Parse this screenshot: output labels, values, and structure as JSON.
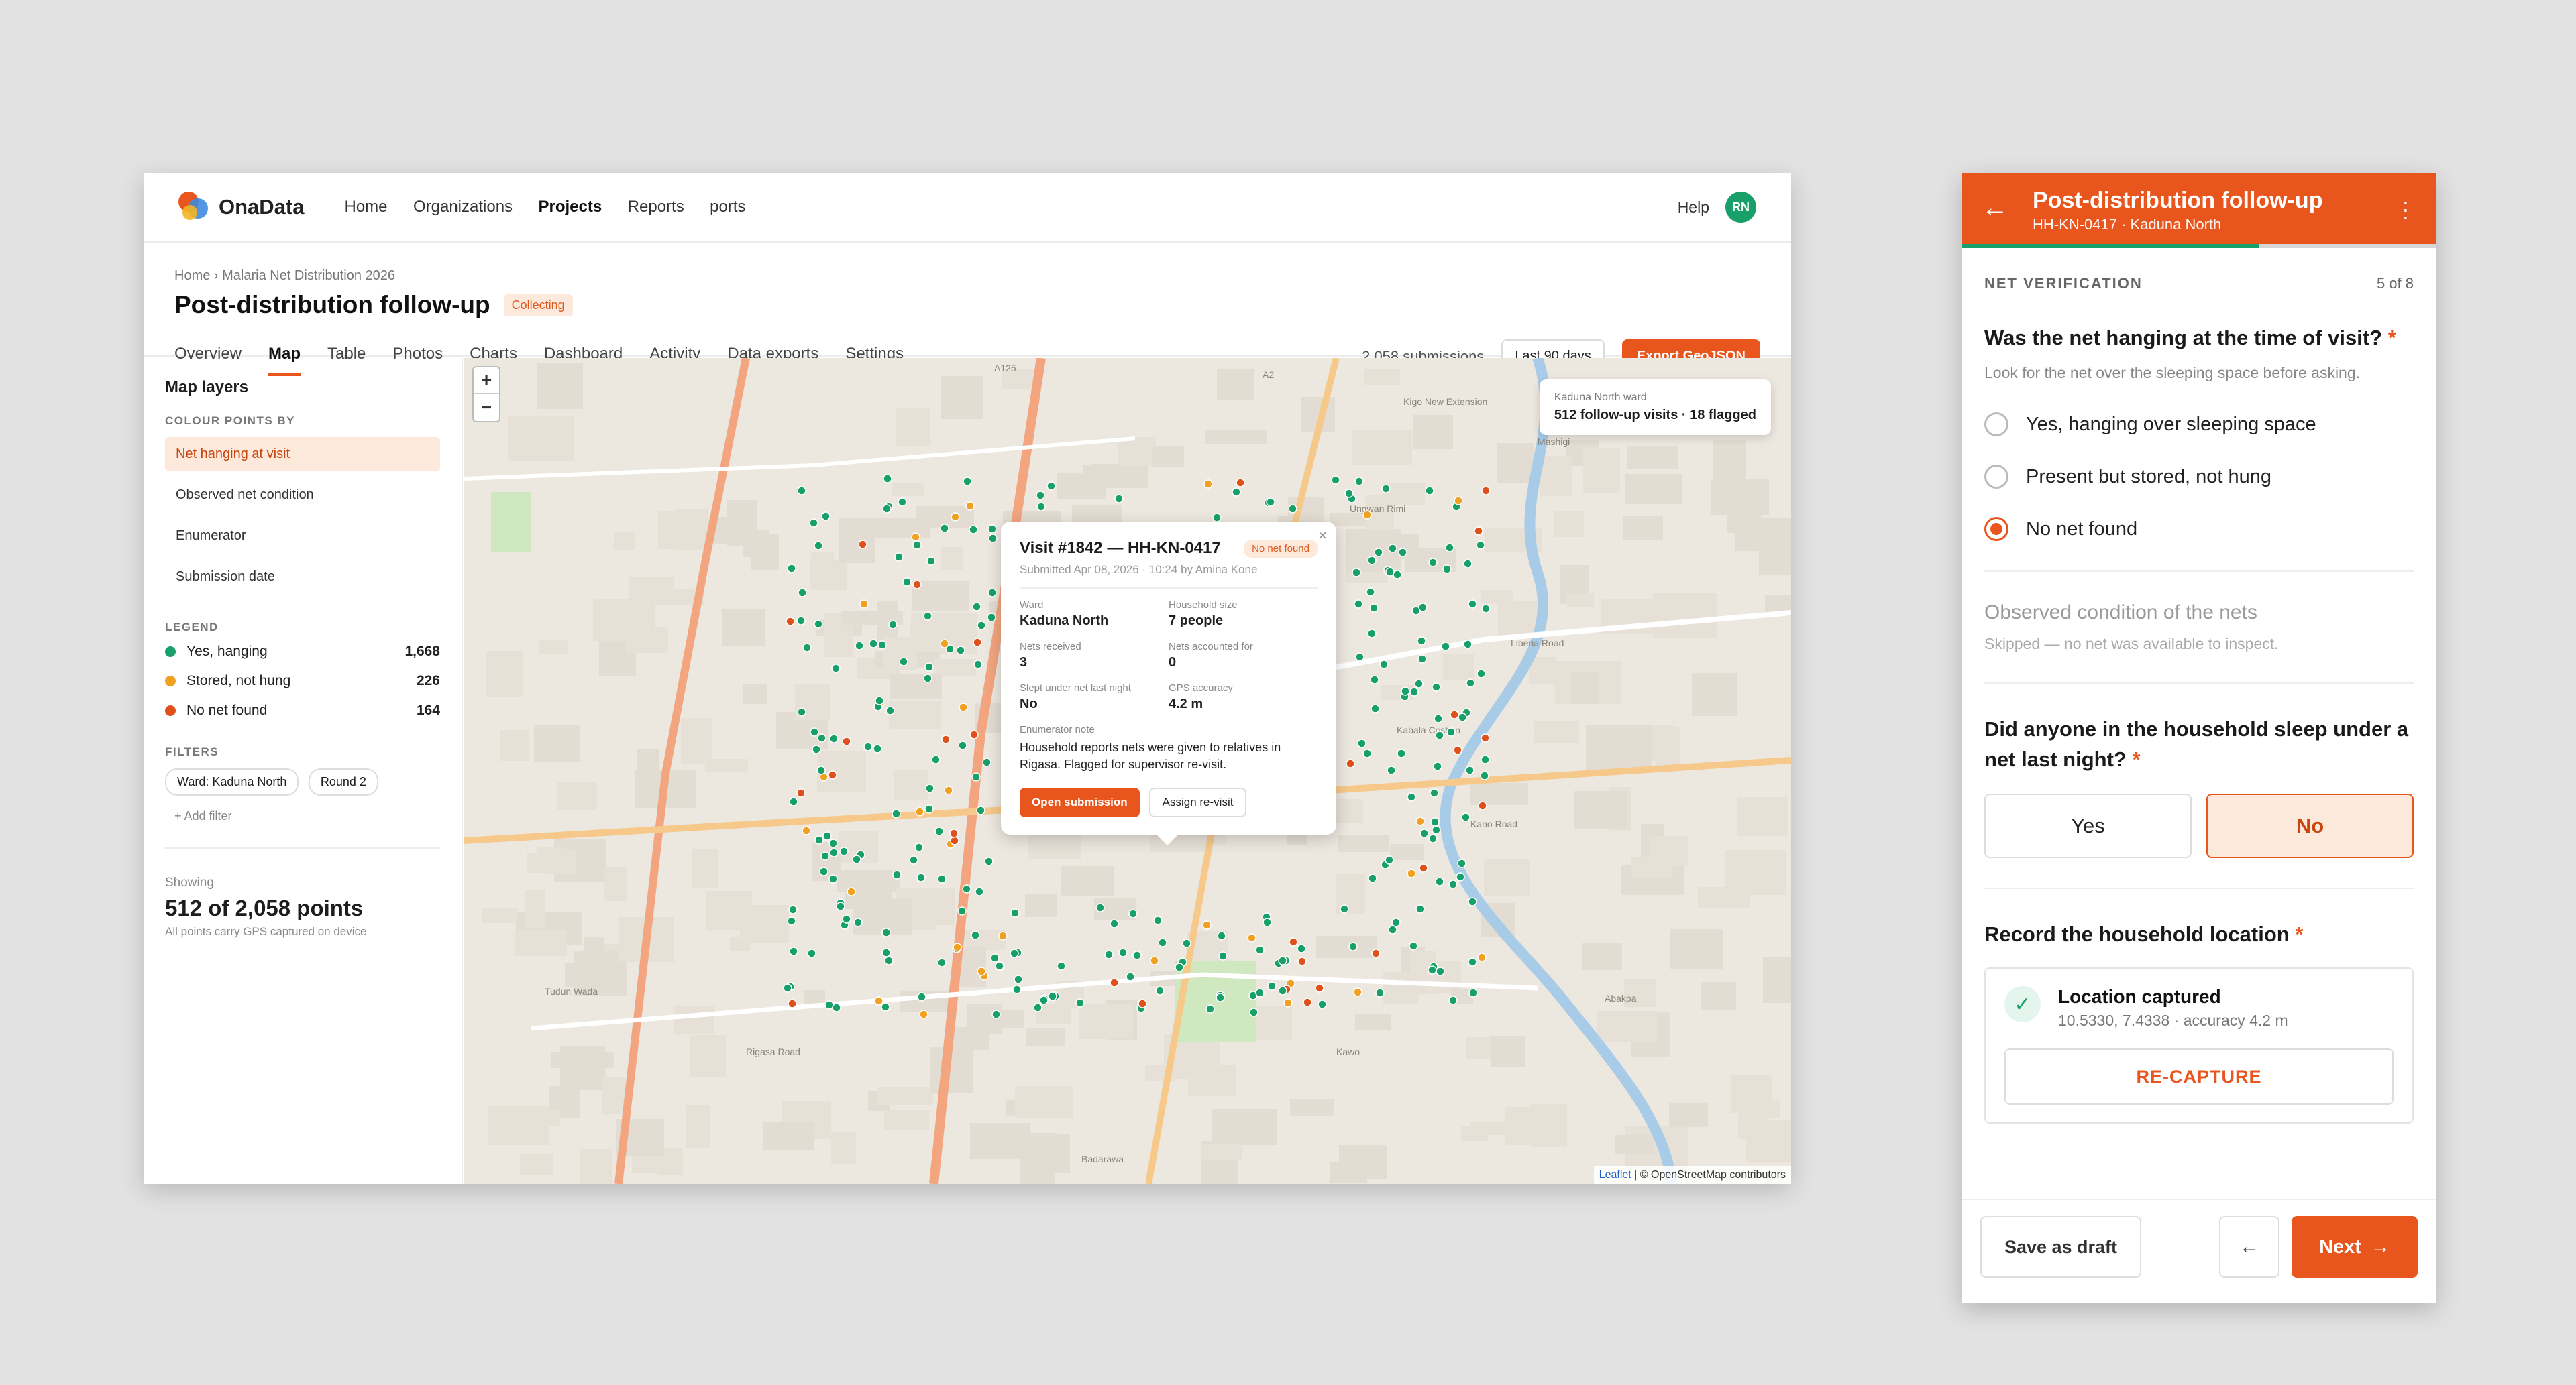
{
  "app": {
    "logo_text": "OnaData",
    "nav": [
      "Home",
      "Organizations",
      "Projects",
      "Reports",
      "ports"
    ],
    "active_nav": "Projects",
    "help": "Help",
    "avatar_initials": "RN"
  },
  "header": {
    "breadcrumb": "Home  ›  Malaria Net Distribution 2026",
    "title": "Post-distribution follow-up",
    "status_badge": "Collecting",
    "tabs": [
      "Overview",
      "Map",
      "Table",
      "Photos",
      "Charts",
      "Dashboard",
      "Activity",
      "Data exports",
      "Settings"
    ],
    "active_tab": "Map",
    "submissions": "2,058 submissions",
    "range_button": "Last 90 days",
    "export_button": "Export GeoJSON"
  },
  "sidebar": {
    "heading": "Map layers",
    "colour_label": "COLOUR POINTS BY",
    "colour_options": [
      "Net hanging at visit",
      "Observed net condition",
      "Enumerator",
      "Submission date"
    ],
    "legend_label": "LEGEND",
    "legend": [
      {
        "label": "Yes, hanging",
        "count": "1,668",
        "color": "#17a06a"
      },
      {
        "label": "Stored, not hung",
        "count": "226",
        "color": "#f0a121"
      },
      {
        "label": "No net found",
        "count": "164",
        "color": "#e0501b"
      }
    ],
    "filters_label": "FILTERS",
    "filters": [
      "Ward: Kaduna North",
      "Round 2"
    ],
    "add_filter": "+ Add filter",
    "showing_label": "Showing",
    "showing_value": "512 of 2,058 points",
    "showing_sub": "All points carry GPS captured on device"
  },
  "map": {
    "zoom_in": "+",
    "zoom_out": "−",
    "ward_label": "Kaduna North ward",
    "ward_value": "512 follow-up visits · 18 flagged",
    "attribution_leaflet": "Leaflet",
    "attribution_rest": " | © OpenStreetMap contributors",
    "popup": {
      "title": "Visit #1842 — HH-KN-0417",
      "badge": "No net found",
      "subtitle": "Submitted Apr 08, 2026 · 10:24 by Amina Kone",
      "fields": [
        {
          "k": "Ward",
          "v": "Kaduna North"
        },
        {
          "k": "Household size",
          "v": "7 people"
        },
        {
          "k": "Nets received",
          "v": "3"
        },
        {
          "k": "Nets accounted for",
          "v": "0"
        },
        {
          "k": "Slept under net last night",
          "v": "No"
        },
        {
          "k": "GPS accuracy",
          "v": "4.2 m"
        }
      ],
      "note_label": "Enumerator note",
      "note": "Household reports nets were given to relatives in Rigasa. Flagged for supervisor re-visit.",
      "open_button": "Open submission",
      "assign_button": "Assign re-visit",
      "close": "×"
    },
    "place_labels": [
      "A125",
      "A2",
      "Kigo New Extension",
      "Mashigi",
      "Ungwan Rimi",
      "Kabala Costain",
      "Badarawa",
      "Tudun Wada",
      "Rigasa Road",
      "Liberia Road",
      "Kano Road",
      "Abakpa",
      "Kawo"
    ]
  },
  "mobile": {
    "title": "Post-distribution follow-up",
    "subtitle": "HH-KN-0417 · Kaduna North",
    "progress": 0.625,
    "section": "NET VERIFICATION",
    "step": "5 of 8",
    "q1": "Was the net hanging at the time of visit?",
    "q1_hint": "Look for the net over the sleeping space before asking.",
    "q1_options": [
      "Yes, hanging over sleeping space",
      "Present but stored, not hung",
      "No net found"
    ],
    "q1_selected": "No net found",
    "q2": "Observed condition of the nets",
    "q2_note": "Skipped — no net was available to inspect.",
    "q3": "Did anyone in the household sleep under a net last night?",
    "q3_yes": "Yes",
    "q3_no": "No",
    "q3_selected": "No",
    "q4": "Record the household location",
    "loc_title": "Location captured",
    "loc_coords": "10.5330, 7.4338 · accuracy 4.2 m",
    "recapture": "RE-CAPTURE",
    "save_draft": "Save as draft",
    "next": "Next",
    "required_mark": "*"
  },
  "colors": {
    "accent": "#e8551d",
    "green": "#17a06a",
    "amber": "#f0a121",
    "red": "#e0501b"
  }
}
